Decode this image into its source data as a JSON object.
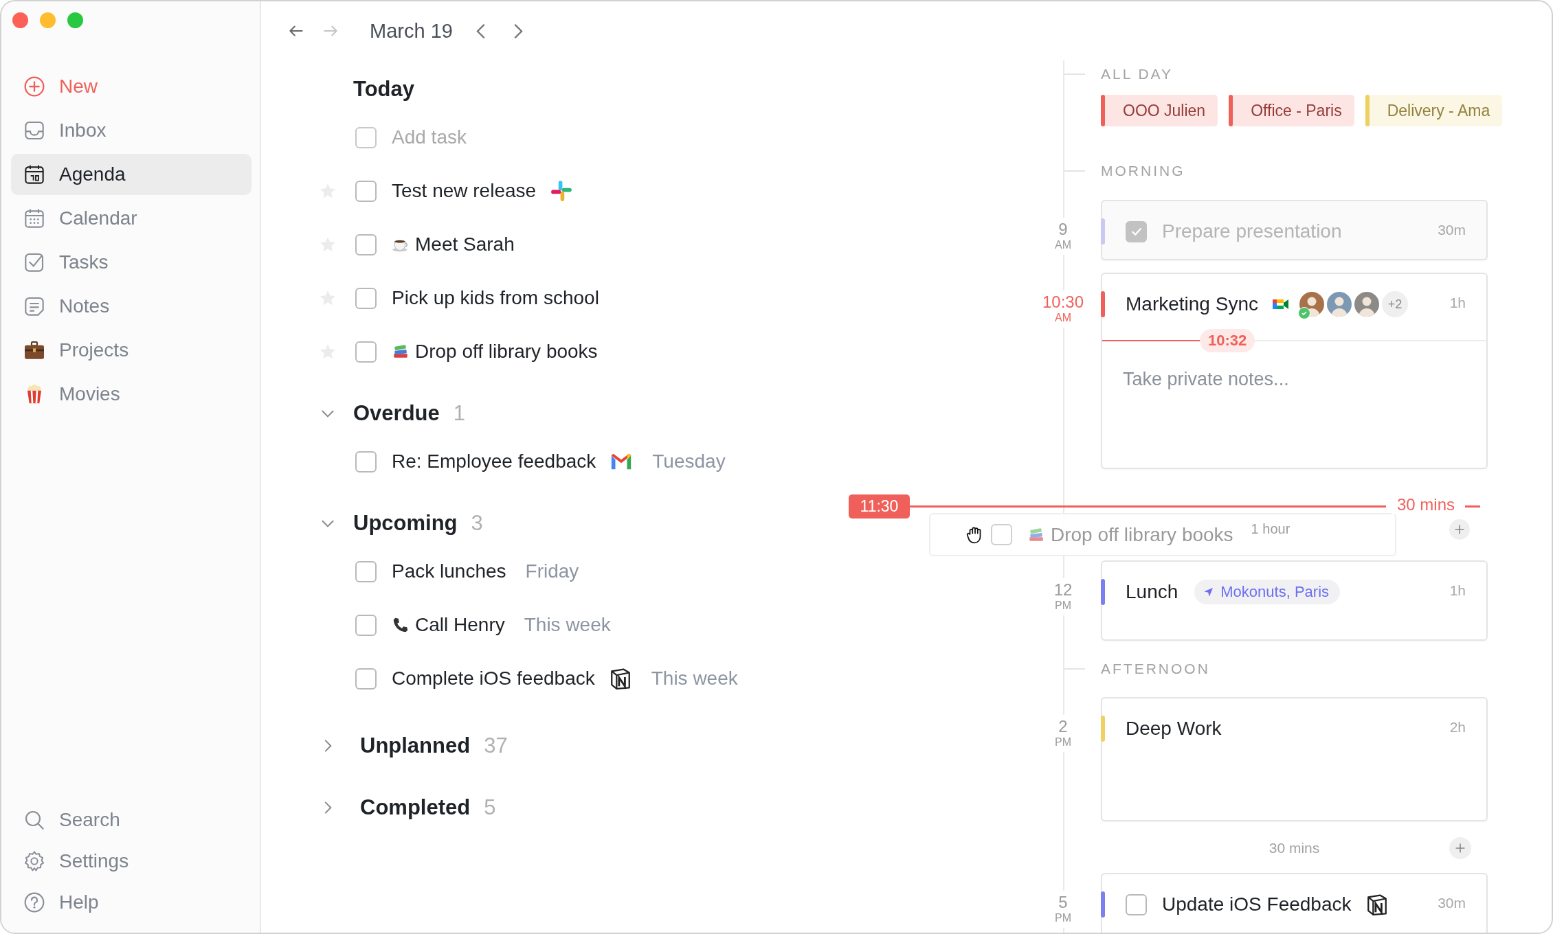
{
  "sidebar": {
    "items": [
      {
        "label": "New",
        "kind": "action",
        "selected": false
      },
      {
        "label": "Inbox",
        "kind": "view",
        "selected": false
      },
      {
        "label": "Agenda",
        "kind": "view",
        "selected": true
      },
      {
        "label": "Calendar",
        "kind": "view",
        "selected": false
      },
      {
        "label": "Tasks",
        "kind": "view",
        "selected": false
      },
      {
        "label": "Notes",
        "kind": "view",
        "selected": false
      },
      {
        "label": "Projects",
        "kind": "view",
        "selected": false
      },
      {
        "label": "Movies",
        "kind": "view",
        "selected": false
      }
    ],
    "footer": [
      {
        "label": "Search"
      },
      {
        "label": "Settings"
      },
      {
        "label": "Help"
      }
    ]
  },
  "toolbar": {
    "history": [
      {
        "disabled": false
      },
      {
        "disabled": true
      }
    ],
    "date": "March 19"
  },
  "task_sections": [
    {
      "title": "Today",
      "add_task": {
        "placeholder": "Add task",
        "checked": false
      },
      "tasks": [
        {
          "title": "Test new release",
          "starred": false,
          "checked": false
        },
        {
          "title": "Meet Sarah",
          "starred": false,
          "checked": false
        },
        {
          "title": "Pick up kids from school",
          "starred": false,
          "checked": false
        },
        {
          "title": "Drop off library books",
          "starred": false,
          "checked": false
        }
      ]
    },
    {
      "title": "Overdue",
      "count": "1",
      "expanded": true,
      "tasks": [
        {
          "title": "Re: Employee feedback",
          "due": "Tuesday",
          "checked": false
        }
      ]
    },
    {
      "title": "Upcoming",
      "count": "3",
      "expanded": true,
      "tasks": [
        {
          "title": "Pack lunches",
          "due": "Friday",
          "checked": false
        },
        {
          "title": "Call Henry",
          "due": "This week",
          "checked": false
        },
        {
          "title": "Complete iOS feedback",
          "due": "This week",
          "checked": false
        }
      ]
    },
    {
      "title": "Unplanned",
      "count": "37",
      "expanded": false
    },
    {
      "title": "Completed",
      "count": "5",
      "expanded": false
    }
  ],
  "timeline": {
    "all_day": {
      "label": "ALL DAY",
      "events": [
        {
          "title": "OOO Julien",
          "color": "#f0605a"
        },
        {
          "title": "Office - Paris",
          "color": "#f0605a"
        },
        {
          "title": "Delivery - Ama",
          "color": "#ecd060"
        }
      ]
    },
    "rows": [
      {
        "kind": "section",
        "label": "MORNING"
      },
      {
        "kind": "task",
        "hour": "9",
        "period": "AM",
        "current": false,
        "title": "Prepare presentation",
        "duration": "30m",
        "color": "#c9c9f2",
        "checked": true
      },
      {
        "kind": "meeting",
        "hour": "10:30",
        "period": "AM",
        "current": true,
        "title": "Marketing Sync",
        "duration": "1h",
        "color": "#f0605a",
        "attendees": [
          {
            "accepted": true
          },
          {
            "accepted": false
          },
          {
            "accepted": false
          }
        ],
        "more_attendees": "+2",
        "now": "10:32",
        "notes_placeholder": "Take private notes..."
      },
      {
        "kind": "event",
        "hour": "12",
        "period": "PM",
        "current": false,
        "title": "Lunch",
        "duration": "1h",
        "color": "#7b7ff0",
        "location": "Mokonuts, Paris"
      },
      {
        "kind": "section",
        "label": "AFTERNOON"
      },
      {
        "kind": "event",
        "hour": "2",
        "period": "PM",
        "current": false,
        "title": "Deep Work",
        "duration": "2h",
        "color": "#f0d060"
      },
      {
        "kind": "gap",
        "label": "30 mins"
      },
      {
        "kind": "task",
        "hour": "5",
        "period": "PM",
        "current": false,
        "title": "Update iOS Feedback",
        "duration": "30m",
        "color": "#7b7ff0",
        "checked": false
      }
    ],
    "drag": {
      "time": "11:30",
      "gap": "30 mins",
      "title": "Drop off library books",
      "duration": "1 hour",
      "checked": false
    }
  }
}
